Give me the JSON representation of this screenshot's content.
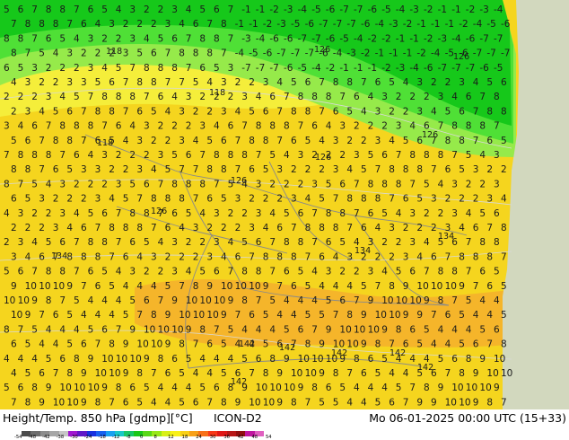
{
  "map": {
    "colors": {
      "warm": "#f5d51e",
      "warm_light": "#f5ee3a",
      "warm_orange": "#f5b52a",
      "green": "#16c81a",
      "green_light": "#4fe036",
      "green_pale": "#96ea4a",
      "sea": "#d2d8be",
      "border": "#8a8a8a",
      "contour": "#d8d8d8"
    },
    "isolines": [
      "118",
      "118",
      "118",
      "126",
      "126",
      "126",
      "126",
      "126",
      "126",
      "134",
      "134",
      "134",
      "142",
      "142",
      "142",
      "142",
      "142",
      "142"
    ]
  },
  "footer": {
    "title": "Height/Temp. 850 hPa [gdmp][°C]",
    "model": "ICON-D2",
    "timestamp": "Mo 06-01-2025 00:00 UTC (15+33)",
    "scale_colors": [
      "#4b4b4b",
      "#6e6e6e",
      "#8d8d8d",
      "#a6a6a6",
      "#c6c6c6",
      "#a018d0",
      "#6018c8",
      "#1830e0",
      "#1860f0",
      "#18a0f0",
      "#18c8c8",
      "#18c868",
      "#18c818",
      "#58d818",
      "#98e818",
      "#d8f018",
      "#f8f018",
      "#f8d018",
      "#f8a018",
      "#f87018",
      "#f83818",
      "#e01818",
      "#b81818",
      "#901010",
      "#c018a0",
      "#e060c0"
    ],
    "scale_labels": [
      "-54",
      "-48",
      "-42",
      "-38",
      "-30",
      "-24",
      "-18",
      "-12",
      "-8",
      "0",
      "8",
      "12",
      "18",
      "24",
      "30",
      "36",
      "42",
      "48",
      "54"
    ]
  }
}
